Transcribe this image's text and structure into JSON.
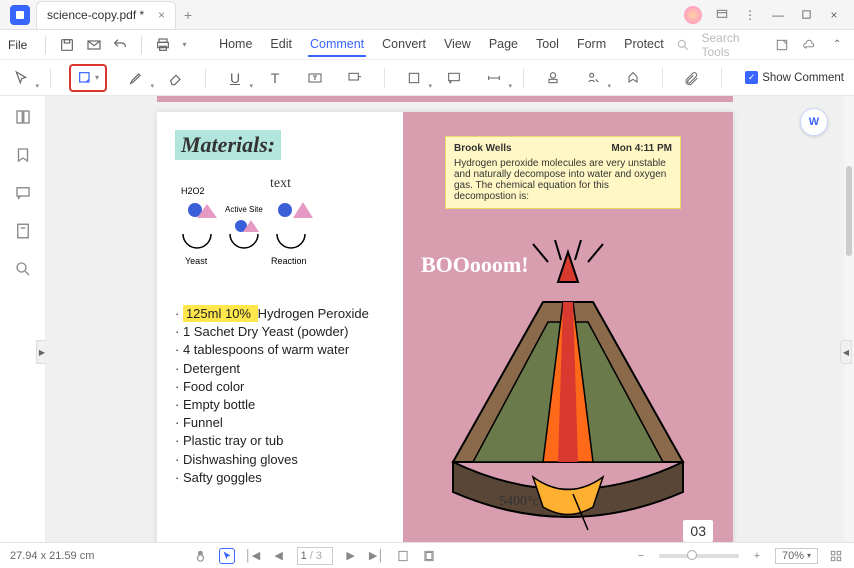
{
  "window": {
    "tab_title": "science-copy.pdf *"
  },
  "menu": {
    "file": "File",
    "tabs": [
      "Home",
      "Edit",
      "Comment",
      "Convert",
      "View",
      "Page",
      "Tool",
      "Form",
      "Protect"
    ],
    "active_tab": "Comment",
    "search_placeholder": "Search Tools"
  },
  "toolbar": {
    "show_comment": "Show Comment"
  },
  "document": {
    "materials_heading": "Materials:",
    "diagram": {
      "text_label": "text",
      "h2o2": "H2O2",
      "active_site": "Active Site",
      "yeast": "Yeast",
      "reaction": "Reaction"
    },
    "highlight_text": "125ml 10% ",
    "highlight_tail": "Hydrogen Peroxide",
    "items": [
      "1 Sachet Dry Yeast (powder)",
      "4 tablespoons of warm water",
      "Detergent",
      "Food color",
      "Empty bottle",
      "Funnel",
      "Plastic tray or tub",
      "Dishwashing gloves",
      "Safty goggles"
    ],
    "boom_text": "BOOooom!",
    "temp_label": "5400°c",
    "page_number": "03"
  },
  "note": {
    "author": "Brook Wells",
    "date": "Mon 4:11 PM",
    "body": "Hydrogen peroxide molecules are very unstable and naturally decompose into water and oxygen gas. The chemical equation for this decompostion is:"
  },
  "status": {
    "dimensions": "27.94 x 21.59 cm",
    "page_current": "1",
    "page_total": "/ 3",
    "zoom": "70%"
  }
}
